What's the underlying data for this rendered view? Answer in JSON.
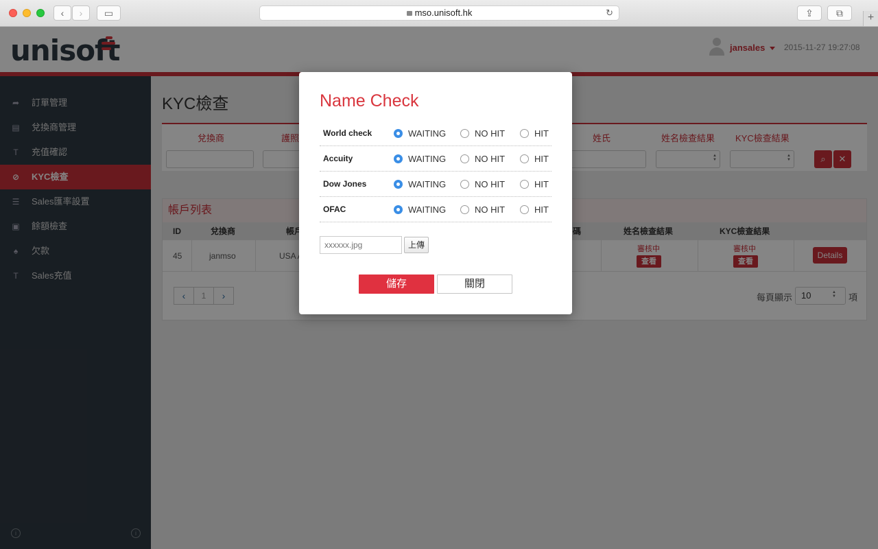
{
  "browser": {
    "url": "mso.unisoft.hk"
  },
  "header": {
    "logo_text": "unisoft",
    "username": "jansales",
    "datetime": "2015-11-27 19:27:08"
  },
  "sidebar": {
    "items": [
      {
        "label": "訂單管理",
        "icon": "share-icon"
      },
      {
        "label": "兌換商管理",
        "icon": "building-icon"
      },
      {
        "label": "充值確認",
        "icon": "tee-icon"
      },
      {
        "label": "KYC檢查",
        "icon": "check-circle-icon",
        "active": true
      },
      {
        "label": "Sales匯率設置",
        "icon": "sliders-icon"
      },
      {
        "label": "餘額檢查",
        "icon": "document-icon"
      },
      {
        "label": "欠款",
        "icon": "bell-icon"
      },
      {
        "label": "Sales充值",
        "icon": "tee-icon"
      }
    ]
  },
  "page": {
    "title": "KYC檢查",
    "filter_headers": [
      "兌換商",
      "護照",
      "姓氏",
      "姓名檢查結果",
      "KYC檢查結果"
    ],
    "list": {
      "title": "帳戶列表",
      "columns": [
        "ID",
        "兌換商",
        "帳戶",
        "碼",
        "姓名檢查結果",
        "KYC檢查結果"
      ],
      "rows": [
        {
          "id": "45",
          "exchanger": "janmso",
          "account": "USA A",
          "name_status": "審核中",
          "kyc_status": "審核中",
          "view_label": "查看",
          "details_label": "Details"
        }
      ]
    },
    "pagination": {
      "current_page": "1",
      "per_page_label": "每頁顯示",
      "per_page_value": "10",
      "per_page_unit": "項"
    }
  },
  "modal": {
    "title": "Name Check",
    "options": [
      "WAITING",
      "NO HIT",
      "HIT"
    ],
    "checks": [
      {
        "name": "World check",
        "selected": "WAITING"
      },
      {
        "name": "Accuity",
        "selected": "WAITING"
      },
      {
        "name": "Dow Jones",
        "selected": "WAITING"
      },
      {
        "name": "OFAC",
        "selected": "WAITING"
      }
    ],
    "file_placeholder": "xxxxxx.jpg",
    "upload_label": "上傳",
    "save_label": "儲存",
    "close_label": "關閉"
  },
  "colors": {
    "accent": "#c9303a",
    "radio_selected": "#3a8ee6",
    "sidebar_bg": "#2f3a43"
  }
}
